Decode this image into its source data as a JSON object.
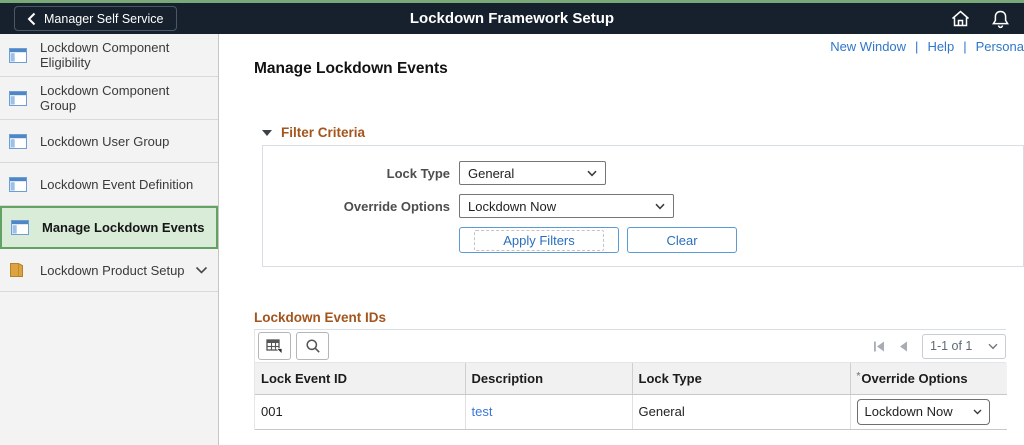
{
  "header": {
    "back_label": "Manager Self Service",
    "title": "Lockdown Framework Setup"
  },
  "sidebar": {
    "items": [
      {
        "label": "Lockdown Component Eligibility"
      },
      {
        "label": "Lockdown Component Group"
      },
      {
        "label": "Lockdown User Group"
      },
      {
        "label": "Lockdown Event Definition"
      },
      {
        "label": "Manage Lockdown Events"
      },
      {
        "label": "Lockdown Product Setup"
      }
    ],
    "selected_index": 4
  },
  "topbar_links": {
    "new_window": "New Window",
    "help": "Help",
    "personalize": "Persona",
    "separator": "|"
  },
  "page": {
    "title": "Manage Lockdown Events"
  },
  "filter": {
    "section_title": "Filter Criteria",
    "lock_type_label": "Lock Type",
    "lock_type_value": "General",
    "override_label": "Override Options",
    "override_value": "Lockdown Now",
    "apply_label": "Apply Filters",
    "clear_label": "Clear"
  },
  "grid": {
    "section_title": "Lockdown Event IDs",
    "pagination": "1-1 of 1",
    "required_marker": "*",
    "columns": [
      "Lock Event ID",
      "Description",
      "Lock Type",
      "Override Options"
    ],
    "rows": [
      {
        "lock_event_id": "001",
        "description": "test",
        "lock_type": "General",
        "override_options": "Lockdown Now"
      }
    ]
  },
  "colors": {
    "header_bg": "#17212e",
    "accent_green_strip": "#79a879",
    "selected_item_bg": "#d8ecd8",
    "selected_item_border": "#64a264",
    "section_title_orange": "#a3551d",
    "link_blue": "#2e77c9"
  }
}
